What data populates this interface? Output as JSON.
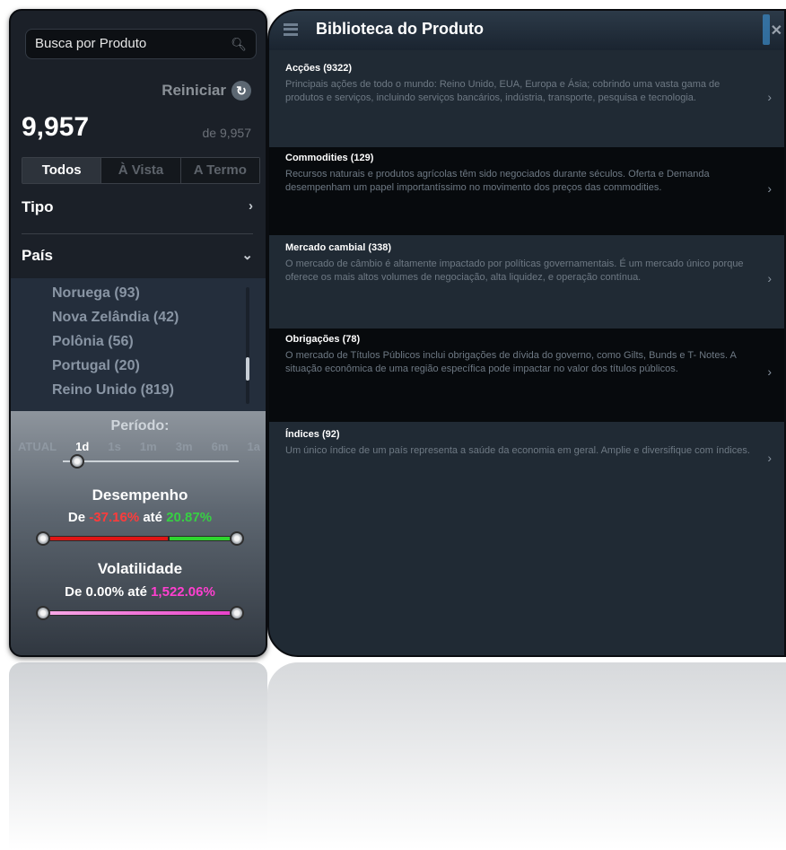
{
  "sidebar": {
    "search_placeholder": "Busca por Produto",
    "reset_label": "Reiniciar",
    "count": "9,957",
    "of_total": "de 9,957",
    "tabs": [
      {
        "label": "Todos",
        "active": true
      },
      {
        "label": "À Vista",
        "active": false
      },
      {
        "label": "A Termo",
        "active": false
      }
    ],
    "filters": {
      "tipo": "Tipo",
      "pais": "País"
    },
    "countries": [
      "Noruega (93)",
      "Nova Zelândia (42)",
      "Polônia (56)",
      "Portugal (20)",
      "Reino Unido (819)"
    ],
    "periodo": {
      "title": "Período:",
      "options": [
        "ATUAL",
        "1d",
        "1s",
        "1m",
        "3m",
        "6m",
        "1a"
      ],
      "selected": "1d"
    },
    "desempenho": {
      "title": "Desempenho",
      "from_label": "De",
      "min": "-37.16%",
      "to_label": "até",
      "max": "20.87%"
    },
    "volatilidade": {
      "title": "Volatilidade",
      "from_label": "De",
      "min": "0.00%",
      "to_label": "até",
      "max": "1,522.06%"
    }
  },
  "library": {
    "title": "Biblioteca do Produto",
    "items": [
      {
        "title": "Acções (9322)",
        "description": "Principais ações de todo o mundo: Reino Unido, EUA, Europa e Ásia; cobrindo uma vasta gama de produtos e serviços, incluindo serviços bancários, indústria, transporte, pesquisa e tecnologia."
      },
      {
        "title": "Commodities (129)",
        "description": "Recursos naturais e produtos agrícolas têm sido negociados durante séculos. Oferta e Demanda desempenham um papel importantíssimo no movimento dos preços das commodities."
      },
      {
        "title": "Mercado cambial (338)",
        "description": "O mercado de câmbio é altamente impactado por políticas governamentais. É um mercado único porque oferece os mais altos volumes de negociação, alta liquidez, e operação contínua."
      },
      {
        "title": "Obrigações (78)",
        "description": "O mercado de Títulos Públicos inclui obrigações de dívida do governo, como Gilts, Bunds e T- Notes. A situação econômica de uma região específica pode impactar no valor dos títulos públicos."
      },
      {
        "title": "Índices (92)",
        "description": "Um único índice de um país representa a saúde da economia em geral. Amplie e diversifique com índices."
      }
    ]
  }
}
